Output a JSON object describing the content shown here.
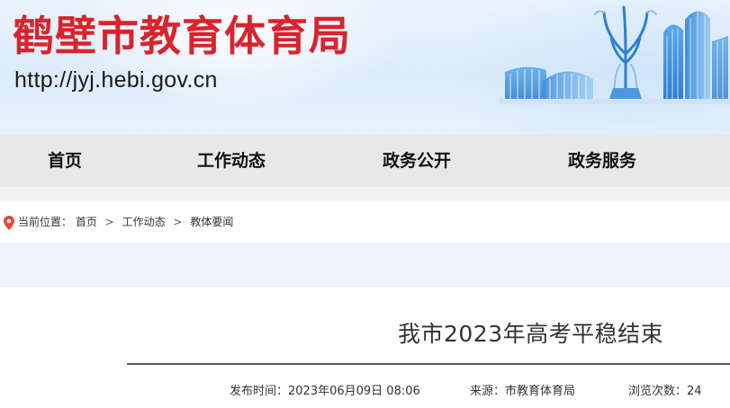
{
  "header": {
    "site_title": "鹤壁市教育体育局",
    "site_url": "http://jyj.hebi.gov.cn",
    "title_color": "#d9232d",
    "skyline_color": "#3a8fdc"
  },
  "nav": {
    "items": [
      {
        "label": "首页"
      },
      {
        "label": "工作动态"
      },
      {
        "label": "政务公开"
      },
      {
        "label": "政务服务"
      }
    ],
    "background": "#e8e8e8"
  },
  "breadcrumb": {
    "prefix": "当前位置：",
    "items": [
      "首页",
      "工作动态",
      "教体要闻"
    ],
    "separator": ">",
    "icon": "location-pin-icon",
    "icon_color": "#e8433b"
  },
  "article": {
    "title": "我市2023年高考平稳结束",
    "publish_time": "发布时间：2023年06月09日 08:06",
    "source": "来源：市教育体育局",
    "views": "浏览次数：24"
  }
}
